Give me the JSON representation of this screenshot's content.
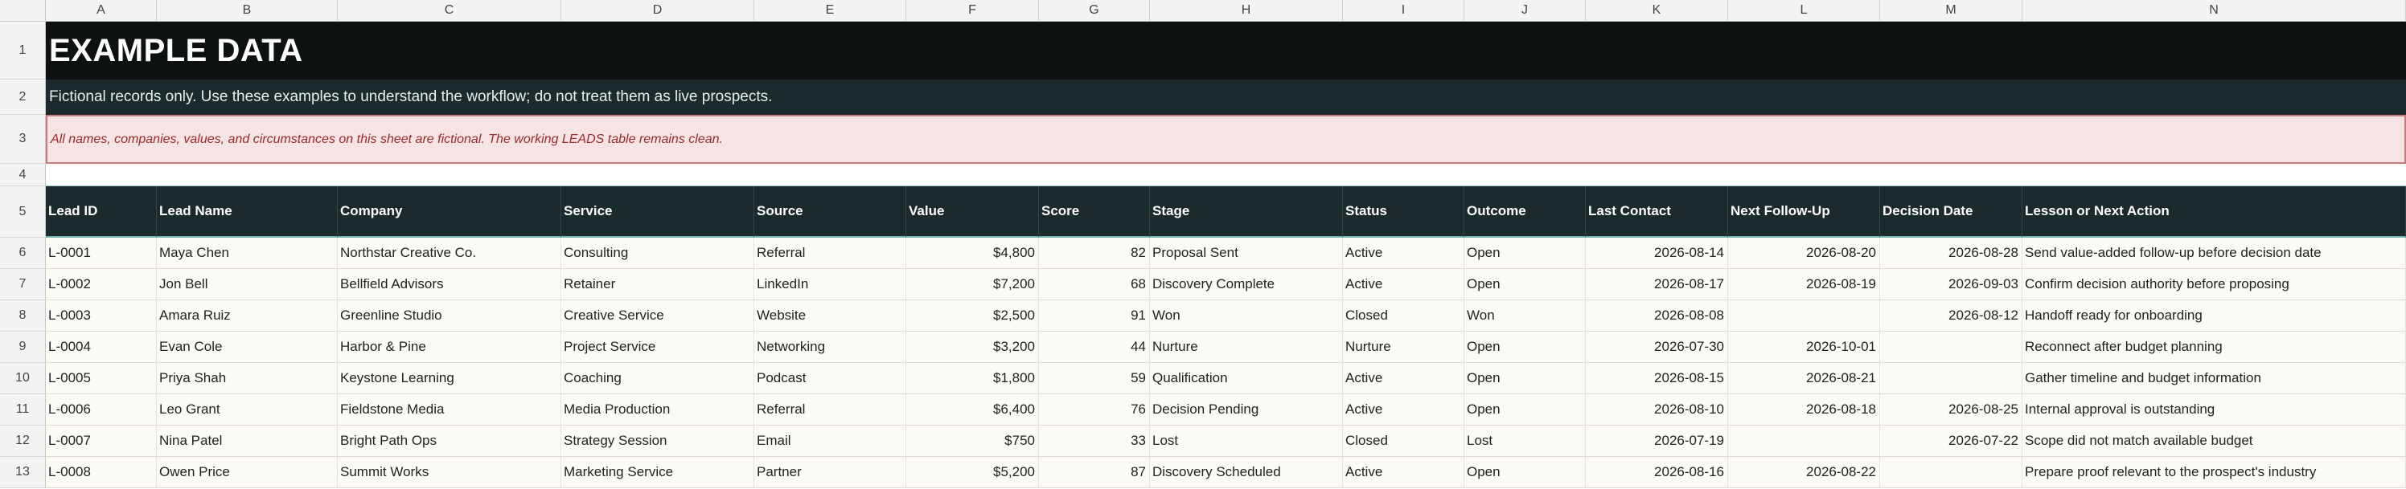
{
  "columns": [
    "A",
    "B",
    "C",
    "D",
    "E",
    "F",
    "G",
    "H",
    "I",
    "J",
    "K",
    "L",
    "M",
    "N"
  ],
  "row_numbers": [
    "1",
    "2",
    "3",
    "4",
    "5",
    "6",
    "7",
    "8",
    "9",
    "10",
    "11",
    "12",
    "13"
  ],
  "banner": {
    "title": "EXAMPLE DATA",
    "subtitle": "Fictional records only. Use these examples to understand the workflow; do not treat them as live prospects.",
    "notice": "All names, companies, values, and circumstances on this sheet are fictional. The working LEADS table remains clean."
  },
  "headers": [
    "Lead ID",
    "Lead Name",
    "Company",
    "Service",
    "Source",
    "Value",
    "Score",
    "Stage",
    "Status",
    "Outcome",
    "Last Contact",
    "Next Follow-Up",
    "Decision Date",
    "Lesson or Next Action"
  ],
  "rows": [
    [
      "L-0001",
      "Maya Chen",
      "Northstar Creative Co.",
      "Consulting",
      "Referral",
      "$4,800",
      "82",
      "Proposal Sent",
      "Active",
      "Open",
      "2026-08-14",
      "2026-08-20",
      "2026-08-28",
      "Send value-added follow-up before decision date"
    ],
    [
      "L-0002",
      "Jon Bell",
      "Bellfield Advisors",
      "Retainer",
      "LinkedIn",
      "$7,200",
      "68",
      "Discovery Complete",
      "Active",
      "Open",
      "2026-08-17",
      "2026-08-19",
      "2026-09-03",
      "Confirm decision authority before proposing"
    ],
    [
      "L-0003",
      "Amara Ruiz",
      "Greenline Studio",
      "Creative Service",
      "Website",
      "$2,500",
      "91",
      "Won",
      "Closed",
      "Won",
      "2026-08-08",
      "",
      "2026-08-12",
      "Handoff ready for onboarding"
    ],
    [
      "L-0004",
      "Evan Cole",
      "Harbor & Pine",
      "Project Service",
      "Networking",
      "$3,200",
      "44",
      "Nurture",
      "Nurture",
      "Open",
      "2026-07-30",
      "2026-10-01",
      "",
      "Reconnect after budget planning"
    ],
    [
      "L-0005",
      "Priya Shah",
      "Keystone Learning",
      "Coaching",
      "Podcast",
      "$1,800",
      "59",
      "Qualification",
      "Active",
      "Open",
      "2026-08-15",
      "2026-08-21",
      "",
      "Gather timeline and budget information"
    ],
    [
      "L-0006",
      "Leo Grant",
      "Fieldstone Media",
      "Media Production",
      "Referral",
      "$6,400",
      "76",
      "Decision Pending",
      "Active",
      "Open",
      "2026-08-10",
      "2026-08-18",
      "2026-08-25",
      "Internal approval is outstanding"
    ],
    [
      "L-0007",
      "Nina Patel",
      "Bright Path Ops",
      "Strategy Session",
      "Email",
      "$750",
      "33",
      "Lost",
      "Closed",
      "Lost",
      "2026-07-19",
      "",
      "2026-07-22",
      "Scope did not match available budget"
    ],
    [
      "L-0008",
      "Owen Price",
      "Summit Works",
      "Marketing Service",
      "Partner",
      "$5,200",
      "87",
      "Discovery Scheduled",
      "Active",
      "Open",
      "2026-08-16",
      "2026-08-22",
      "",
      "Prepare proof relevant to the prospect's industry"
    ]
  ]
}
